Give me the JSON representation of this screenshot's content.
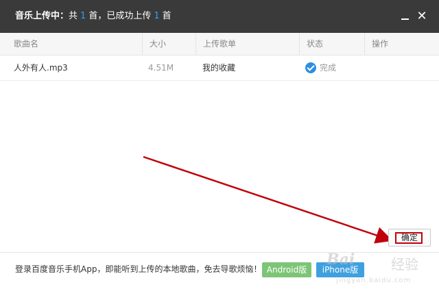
{
  "titlebar": {
    "title": "音乐上传中：",
    "prefix": "共",
    "total": "1",
    "middle": "首，已成功上传",
    "success": "1",
    "suffix": "首",
    "minimize_glyph": "—",
    "close_glyph": "✕"
  },
  "table": {
    "headers": [
      "歌曲名",
      "大小",
      "上传歌单",
      "状态",
      "操作"
    ],
    "rows": [
      {
        "name": "人外有人.mp3",
        "size": "4.51M",
        "playlist": "我的收藏",
        "status": "完成",
        "action": ""
      }
    ]
  },
  "footer": {
    "text": "登录百度音乐手机App，即能听到上传的本地歌曲，免去导歌烦恼！",
    "android_button": "Android版",
    "iphone_button": "iPhone版",
    "confirm_button": "确定"
  },
  "watermark": {
    "brand": "Bai",
    "brand_tail": "经验",
    "sub": "jingyan.baidu.com"
  },
  "colors": {
    "titlebar_bg": "#3a3a3a",
    "accent_blue": "#2e9ff0",
    "android_green": "#7cc576",
    "iphone_blue": "#3fa0e0",
    "annotation_red": "#c0000c"
  },
  "icons": {
    "status_complete": "check-circle-icon",
    "minimize": "minimize-icon",
    "close": "close-icon"
  }
}
